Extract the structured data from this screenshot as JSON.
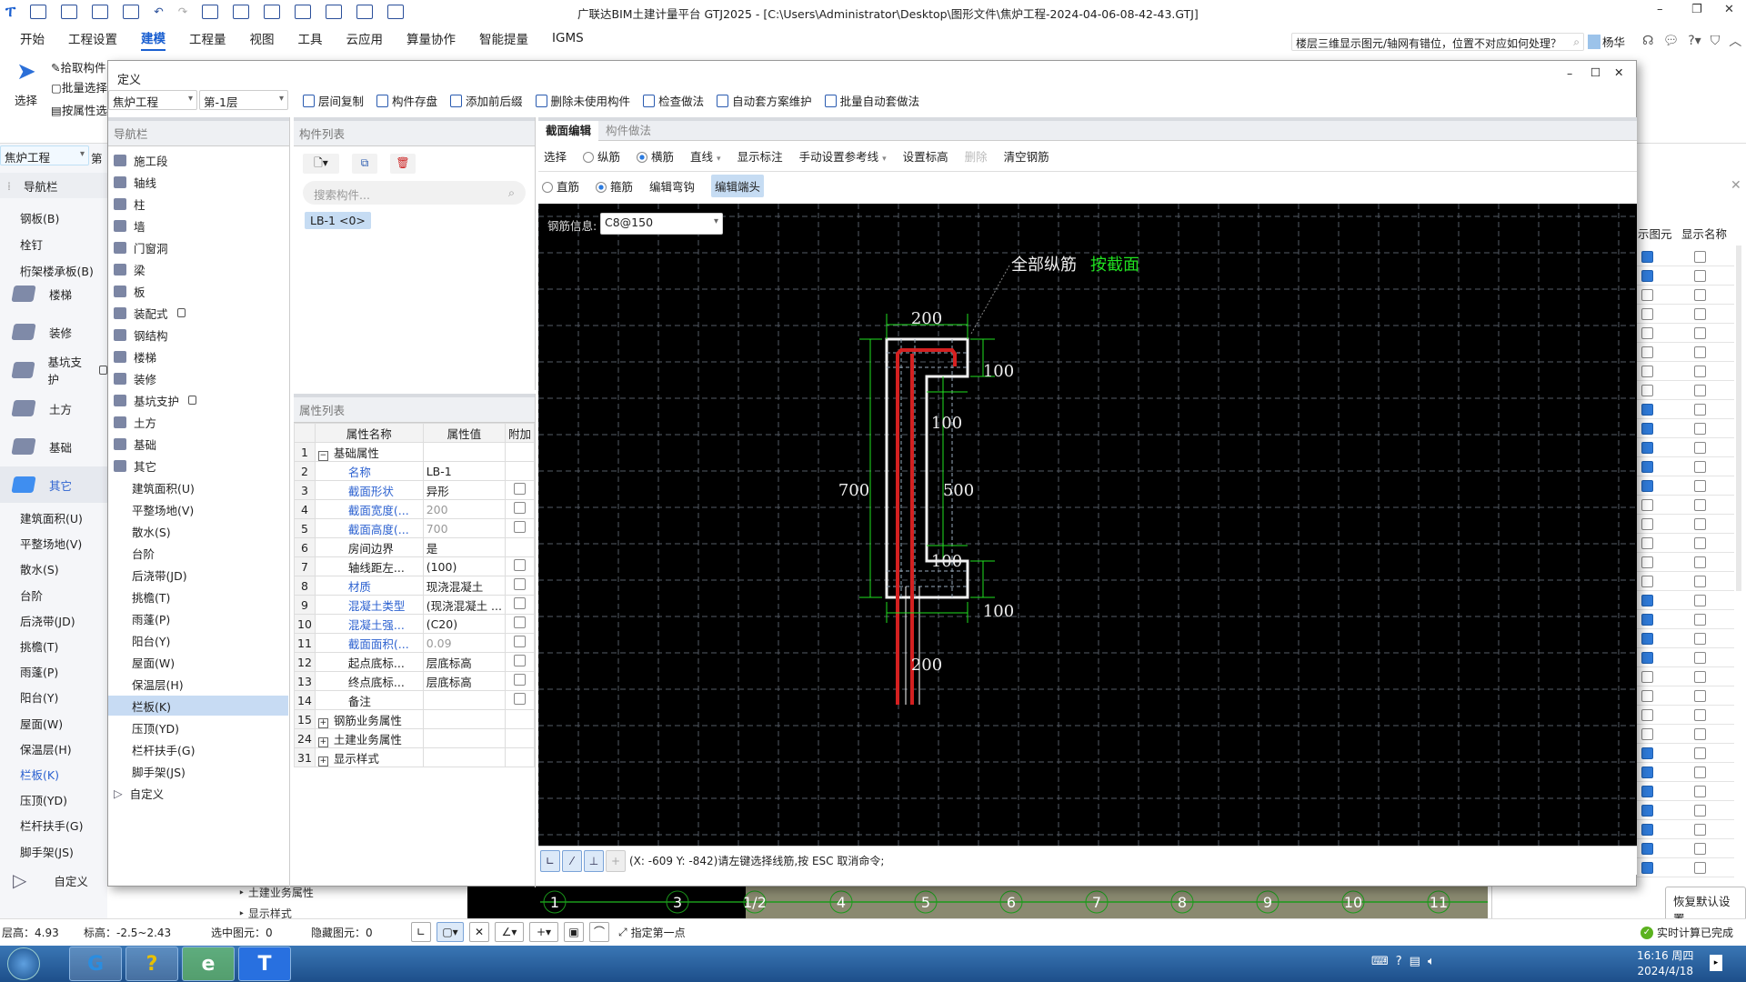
{
  "titlebar": {
    "title": "广联达BIM土建计量平台 GTJ2025 - [C:\\Users\\Administrator\\Desktop\\图形文件\\焦炉工程-2024-04-06-08-42-43.GTJ]"
  },
  "menu": {
    "items": [
      "开始",
      "工程设置",
      "建模",
      "工程量",
      "视图",
      "工具",
      "云应用",
      "算量协作",
      "智能提量",
      "IGMS"
    ],
    "active": "建模"
  },
  "help": {
    "tip": "楼层三维显示图元/轴网有错位，位置不对应如何处理？",
    "user": "杨华"
  },
  "ribbon": {
    "select": "选择",
    "pick": "拾取构件",
    "batch": "批量选择",
    "byattr": "按属性选"
  },
  "main_left": {
    "project": "焦炉工程",
    "floor": "第",
    "nav_title": "导航栏",
    "top_items": [
      "钢板(B)",
      "栓钉",
      "桁架楼承板(B)"
    ],
    "big_items": [
      {
        "label": "楼梯"
      },
      {
        "label": "装修"
      },
      {
        "label": "基坑支护",
        "locked": true
      },
      {
        "label": "土方"
      },
      {
        "label": "基础"
      },
      {
        "label": "其它",
        "active": true
      }
    ],
    "sub_items": [
      "建筑面积(U)",
      "平整场地(V)",
      "散水(S)",
      "台阶",
      "后浇带(JD)",
      "挑檐(T)",
      "雨蓬(P)",
      "阳台(Y)",
      "屋面(W)",
      "保温层(H)",
      "栏板(K)",
      "压顶(YD)",
      "栏杆扶手(G)",
      "脚手架(JS)"
    ],
    "active_sub": "栏板(K)",
    "custom": "自定义"
  },
  "dialog": {
    "title": "定义",
    "project": "焦炉工程",
    "floor": "第-1层",
    "toolbar": [
      "层间复制",
      "构件存盘",
      "添加前后缀",
      "删除未使用构件",
      "检查做法",
      "自动套方案维护",
      "批量自动套做法"
    ],
    "nav": {
      "title": "导航栏",
      "items": [
        {
          "label": "施工段"
        },
        {
          "label": "轴线"
        },
        {
          "label": "柱"
        },
        {
          "label": "墙"
        },
        {
          "label": "门窗洞"
        },
        {
          "label": "梁"
        },
        {
          "label": "板"
        },
        {
          "label": "装配式",
          "locked": true
        },
        {
          "label": "钢结构"
        },
        {
          "label": "楼梯"
        },
        {
          "label": "装修"
        },
        {
          "label": "基坑支护",
          "locked": true
        },
        {
          "label": "土方"
        },
        {
          "label": "基础"
        },
        {
          "label": "其它"
        }
      ],
      "sub_items": [
        "建筑面积(U)",
        "平整场地(V)",
        "散水(S)",
        "台阶",
        "后浇带(JD)",
        "挑檐(T)",
        "雨蓬(P)",
        "阳台(Y)",
        "屋面(W)",
        "保温层(H)",
        "栏板(K)",
        "压顶(YD)",
        "栏杆扶手(G)",
        "脚手架(JS)"
      ],
      "selected": "栏板(K)",
      "custom": "自定义"
    },
    "components": {
      "title": "构件列表",
      "search_placeholder": "搜索构件...",
      "items": [
        "LB-1 <0>"
      ]
    },
    "properties": {
      "title": "属性列表",
      "headers": [
        "属性名称",
        "属性值",
        "附加"
      ],
      "rows": [
        {
          "n": "1",
          "name": "基础属性",
          "value": "",
          "group": "minus"
        },
        {
          "n": "2",
          "name": "名称",
          "value": "LB-1",
          "blue": true
        },
        {
          "n": "3",
          "name": "截面形状",
          "value": "异形",
          "blue": true,
          "cb": true
        },
        {
          "n": "4",
          "name": "截面宽度(...",
          "value": "200",
          "blue": true,
          "grayval": true,
          "cb": true
        },
        {
          "n": "5",
          "name": "截面高度(...",
          "value": "700",
          "blue": true,
          "grayval": true,
          "cb": true
        },
        {
          "n": "6",
          "name": "房间边界",
          "value": "是"
        },
        {
          "n": "7",
          "name": "轴线距左...",
          "value": "(100)",
          "cb": true
        },
        {
          "n": "8",
          "name": "材质",
          "value": "现浇混凝土",
          "blue": true,
          "cb": true
        },
        {
          "n": "9",
          "name": "混凝土类型",
          "value": "(现浇混凝土  ...",
          "blue": true,
          "cb": true
        },
        {
          "n": "10",
          "name": "混凝土强...",
          "value": "(C20)",
          "blue": true,
          "cb": true
        },
        {
          "n": "11",
          "name": "截面面积(...",
          "value": "0.09",
          "blue": true,
          "grayval": true,
          "cb": true
        },
        {
          "n": "12",
          "name": "起点底标...",
          "value": "层底标高",
          "cb": true
        },
        {
          "n": "13",
          "name": "终点底标...",
          "value": "层底标高",
          "cb": true
        },
        {
          "n": "14",
          "name": "备注",
          "value": "",
          "cb": true
        },
        {
          "n": "15",
          "name": "钢筋业务属性",
          "value": "",
          "group": "plus"
        },
        {
          "n": "24",
          "name": "土建业务属性",
          "value": "",
          "group": "plus"
        },
        {
          "n": "31",
          "name": "显示样式",
          "value": "",
          "group": "plus"
        }
      ]
    },
    "editor": {
      "tabs": [
        "截面编辑",
        "构件做法"
      ],
      "active_tab": "截面编辑",
      "toolbar1": {
        "select": "选择",
        "longitudinal": "纵筋",
        "transverse": "横筋",
        "line": "直线",
        "show_dim": "显示标注",
        "ref_line": "手动设置参考线",
        "set_elev": "设置标高",
        "delete": "删除",
        "clear": "清空钢筋"
      },
      "rebar_mode": "横筋",
      "toolbar2": {
        "straight": "直筋",
        "stirrup": "箍筋",
        "edit_hook": "编辑弯钩",
        "edit_end": "编辑端头"
      },
      "shape_mode": "箍筋",
      "rebar_info_label": "钢筋信息:",
      "rebar_info": "C8@150",
      "canvas": {
        "label_all": "全部纵筋",
        "label_section": "按截面",
        "dims": {
          "top": "200",
          "right_top": "100",
          "inner_top": "100",
          "left": "700",
          "inner": "500",
          "inner_bottom": "100",
          "right_bottom": "100",
          "bottom": "200"
        }
      },
      "command": "(X: -609 Y: -842)请左键选择线筋,按 ESC 取消命令;"
    },
    "colors": {
      "rebar": "#d42020",
      "outline": "#f0f0f0",
      "dim": "#20e020",
      "grid": "#555b66"
    }
  },
  "behind": {
    "rows": [
      "土建业务属性",
      "显示样式"
    ],
    "axes": [
      "1",
      "3",
      "1/2",
      "4",
      "5",
      "6",
      "7",
      "8",
      "9",
      "10",
      "11"
    ]
  },
  "right_panel": {
    "headers": [
      "示图元",
      "显示名称"
    ],
    "checked": [
      true,
      true,
      false,
      false,
      false,
      false,
      false,
      false,
      true,
      true,
      true,
      true,
      true,
      false,
      false,
      false,
      false,
      false,
      true,
      true,
      true,
      true,
      false,
      false,
      false,
      false,
      true,
      true,
      true,
      true,
      true,
      true,
      true
    ],
    "reset": "恢复默认设置",
    "calc_status": "实时计算已完成"
  },
  "statusbar": {
    "floor_height": "层高：4.93",
    "elevation": "标高：-2.5~2.43",
    "selected": "选中图元：0",
    "hidden": "隐藏图元：0",
    "hint": "指定第一点"
  },
  "taskbar": {
    "time": "16:16 周四",
    "date": "2024/4/18"
  }
}
